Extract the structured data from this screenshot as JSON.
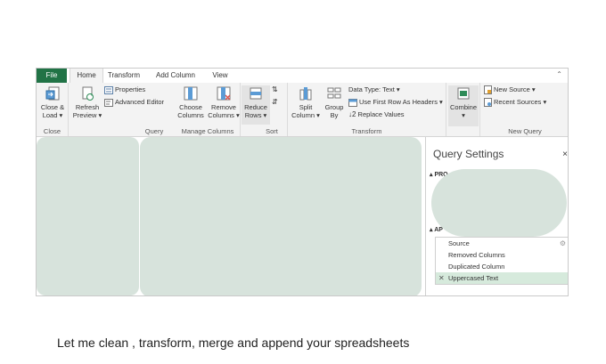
{
  "ribbon": {
    "tabs": [
      {
        "label": "File"
      },
      {
        "label": "Home"
      },
      {
        "label": "Transform"
      },
      {
        "label": "Add Column"
      },
      {
        "label": "View"
      }
    ],
    "close": {
      "close_load": [
        "Close &",
        "Load ▾"
      ],
      "group_label": "Close"
    },
    "query": {
      "refresh": [
        "Refresh",
        "Preview ▾"
      ],
      "properties": "Properties",
      "advanced_editor": "Advanced Editor",
      "group_label": "Query"
    },
    "manage_columns": {
      "choose": [
        "Choose",
        "Columns"
      ],
      "remove": [
        "Remove",
        "Columns ▾"
      ],
      "group_label": "Manage Columns"
    },
    "sort": {
      "reduce": [
        "Reduce",
        "Rows ▾"
      ],
      "group_label": "Sort"
    },
    "transform": {
      "split": [
        "Split",
        "Column ▾"
      ],
      "group_by": [
        "Group",
        "By"
      ],
      "data_type": "Data Type: Text ▾",
      "first_row": "Use First Row As Headers ▾",
      "replace": "Replace Values",
      "group_label": "Transform"
    },
    "combine": {
      "label": [
        "Combine",
        "▾"
      ]
    },
    "new_query": {
      "new_source": "New Source ▾",
      "recent_sources": "Recent Sources ▾",
      "group_label": "New Query"
    }
  },
  "query_settings": {
    "title": "Query Settings",
    "close": "×",
    "properties_header": "▴ PRO",
    "applied_header": "▴ AP",
    "steps": [
      {
        "label": "Source",
        "selected": false
      },
      {
        "label": "Removed Columns",
        "selected": false
      },
      {
        "label": "Duplicated Column",
        "selected": false
      },
      {
        "label": "Uppercased Text",
        "selected": true
      }
    ],
    "gear": "⚙",
    "x_mark": "✕"
  },
  "caption": "Let me clean , transform, merge and append your spreadsheets",
  "colors": {
    "file_tab": "#217346",
    "placeholder": "#d7e3dc",
    "selected_step": "#d6eadc"
  }
}
